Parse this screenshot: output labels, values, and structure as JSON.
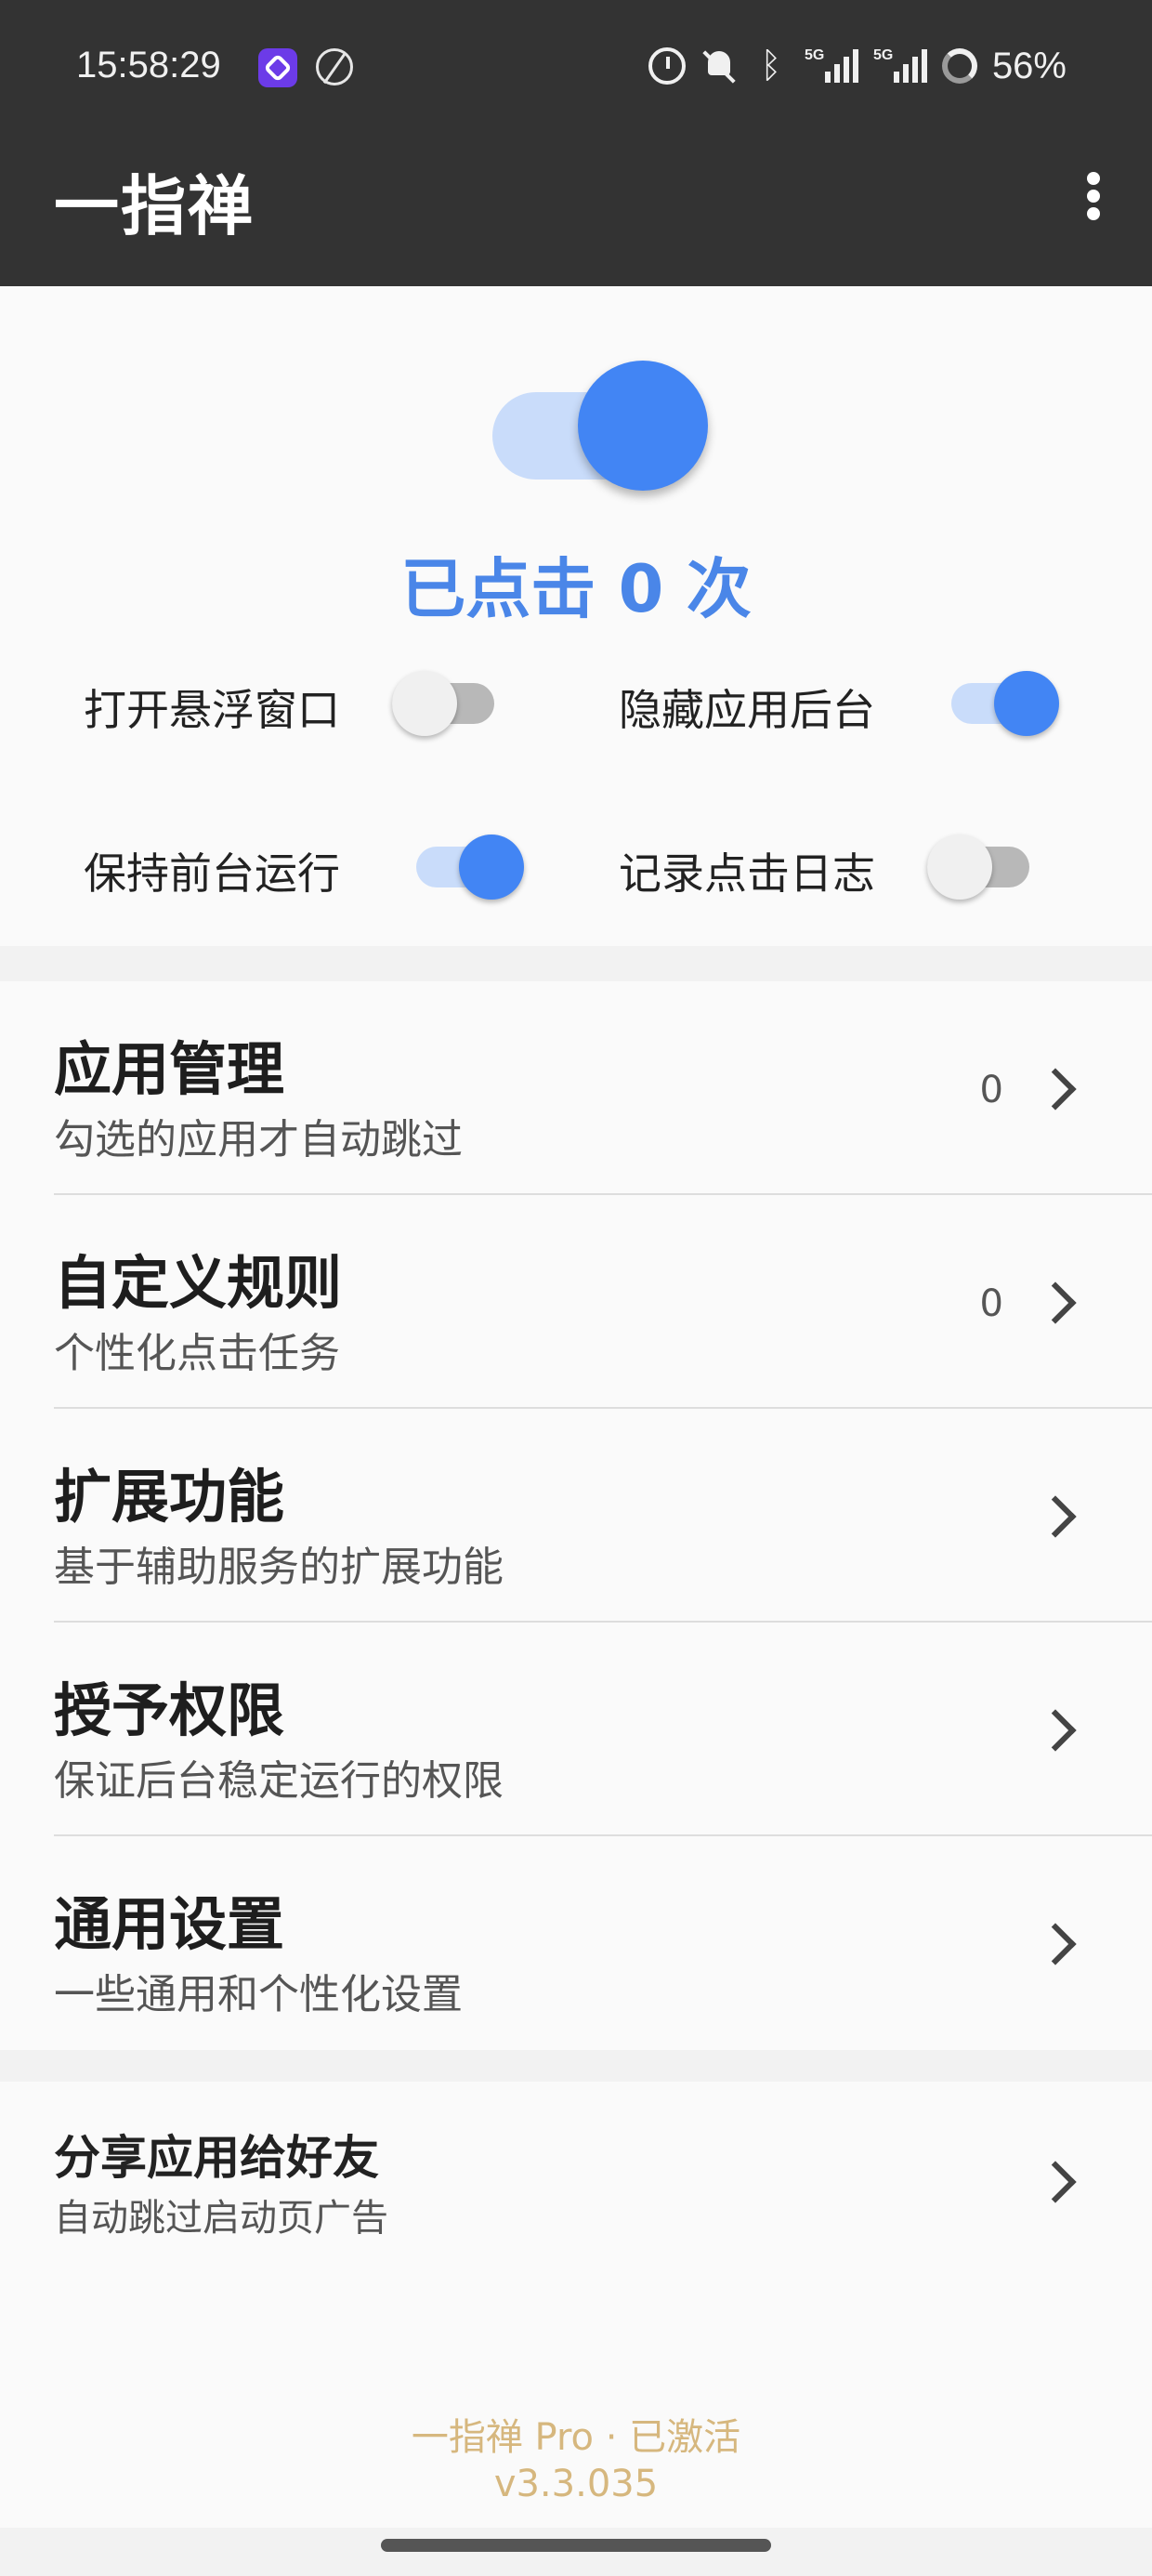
{
  "status_bar": {
    "time": "15:58:29",
    "network": "5G",
    "battery": "56%"
  },
  "app_bar": {
    "title": "一指禅"
  },
  "main": {
    "service_enabled": true,
    "click_count_text": "已点击 0 次",
    "toggles": [
      {
        "label": "打开悬浮窗口",
        "on": false
      },
      {
        "label": "隐藏应用后台",
        "on": true
      },
      {
        "label": "保持前台运行",
        "on": true
      },
      {
        "label": "记录点击日志",
        "on": false
      }
    ]
  },
  "menu": [
    {
      "title": "应用管理",
      "subtitle": "勾选的应用才自动跳过",
      "count": "0"
    },
    {
      "title": "自定义规则",
      "subtitle": "个性化点击任务",
      "count": "0"
    },
    {
      "title": "扩展功能",
      "subtitle": "基于辅助服务的扩展功能"
    },
    {
      "title": "授予权限",
      "subtitle": "保证后台稳定运行的权限"
    },
    {
      "title": "通用设置",
      "subtitle": "一些通用和个性化设置"
    }
  ],
  "share": {
    "title": "分享应用给好友",
    "subtitle": "自动跳过启动页广告"
  },
  "footer": {
    "edition": "一指禅 Pro · 已激活",
    "version": "v3.3.035"
  },
  "colors": {
    "accent": "#4285f4",
    "appbar": "#333333",
    "footer_text": "#d6b77e"
  }
}
